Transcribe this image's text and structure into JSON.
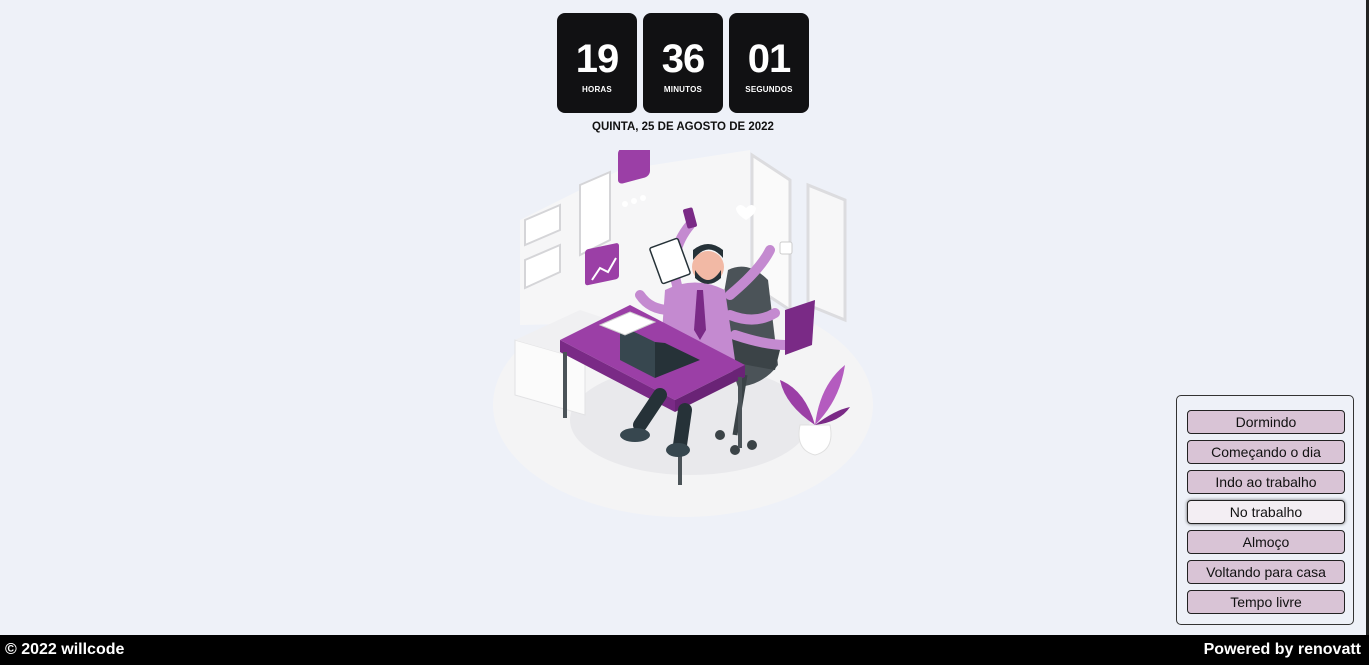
{
  "clock": {
    "hours": "19",
    "hours_label": "HORAS",
    "minutes": "36",
    "minutes_label": "MINUTOS",
    "seconds": "01",
    "seconds_label": "SEGUNDOS"
  },
  "date": "QUINTA, 25 DE AGOSTO DE 2022",
  "status_panel": {
    "options": [
      "Dormindo",
      "Começando o dia",
      "Indo ao trabalho",
      "No trabalho",
      "Almoço",
      "Voltando para casa",
      "Tempo livre"
    ],
    "selected": "No trabalho"
  },
  "footer": {
    "left": "© 2022 willcode",
    "right": "Powered by renovatt"
  },
  "colors": {
    "accent": "#9b3fa6",
    "tile_bg": "#111113",
    "page_bg": "#eef1f8",
    "button_bg": "#d9c4d6"
  }
}
